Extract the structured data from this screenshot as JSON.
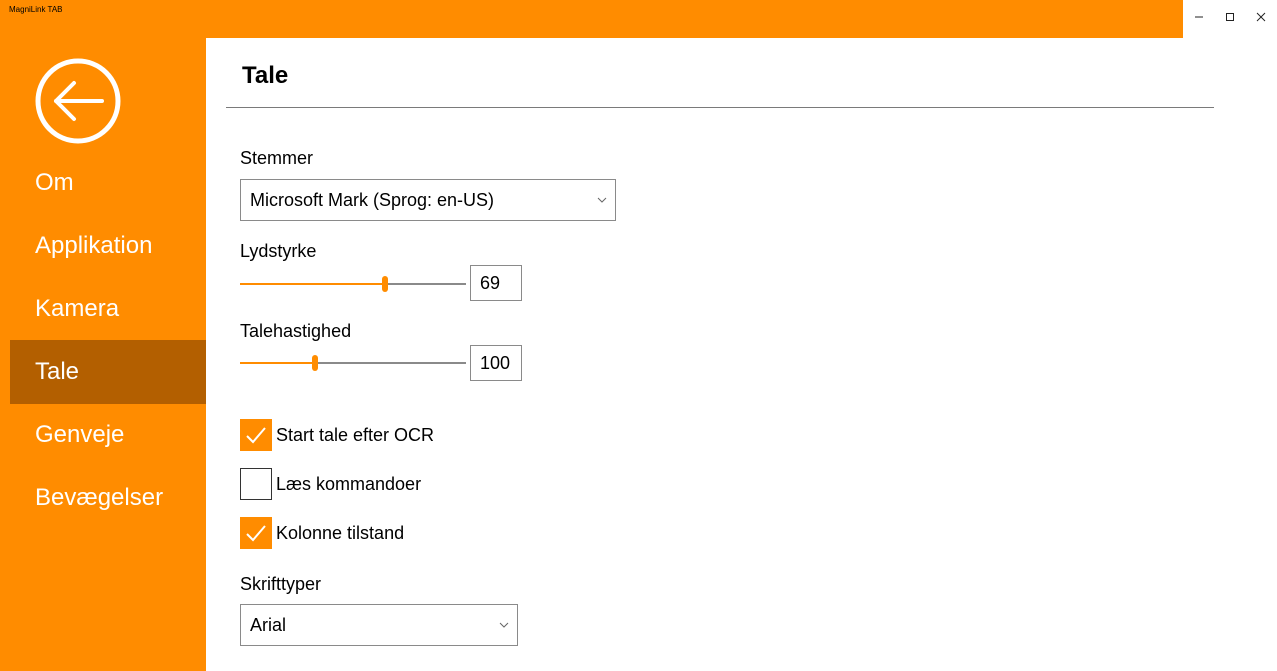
{
  "window": {
    "title": "MagniLink TAB",
    "minimize_glyph": "–",
    "maximize_icon": "maximize-icon",
    "close_icon": "close-icon",
    "accent_color": "#FF8C00",
    "selected_color": "#B35F00"
  },
  "sidebar": {
    "back_icon": "back-arrow-icon",
    "items": [
      {
        "label": "Om",
        "selected": false
      },
      {
        "label": "Applikation",
        "selected": false
      },
      {
        "label": "Kamera",
        "selected": false
      },
      {
        "label": "Tale",
        "selected": true
      },
      {
        "label": "Genveje",
        "selected": false
      },
      {
        "label": "Bevægelser",
        "selected": false
      }
    ]
  },
  "main": {
    "title": "Tale",
    "voice": {
      "label": "Stemmer",
      "selected": "Microsoft Mark (Sprog: en-US)"
    },
    "volume": {
      "label": "Lydstyrke",
      "value": "69",
      "level": 0.64
    },
    "speed": {
      "label": "Talehastighed",
      "value": "100",
      "level": 0.33
    },
    "checkboxes": [
      {
        "label": "Start tale efter OCR",
        "checked": true
      },
      {
        "label": "Læs kommandoer",
        "checked": false
      },
      {
        "label": "Kolonne tilstand",
        "checked": true
      }
    ],
    "font": {
      "label": "Skrifttyper",
      "selected": "Arial"
    }
  }
}
